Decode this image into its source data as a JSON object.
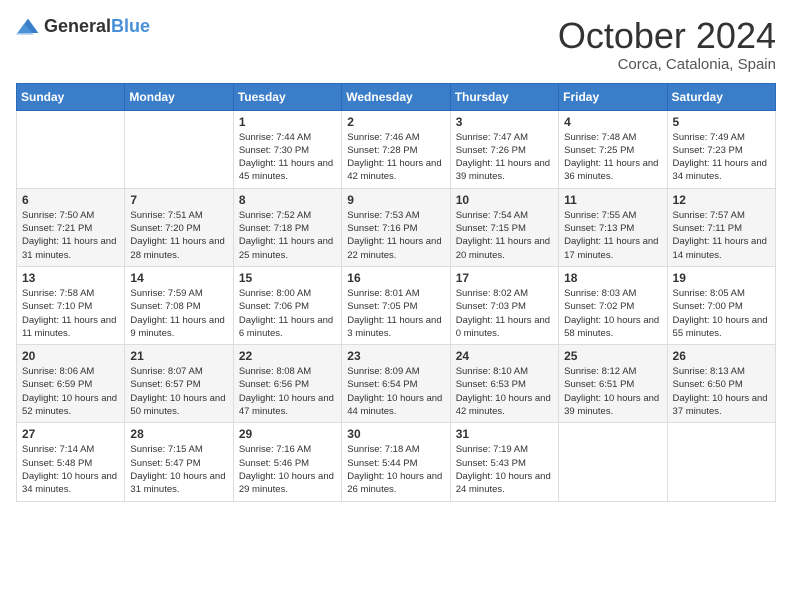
{
  "header": {
    "logo_general": "General",
    "logo_blue": "Blue",
    "month": "October 2024",
    "location": "Corca, Catalonia, Spain"
  },
  "weekdays": [
    "Sunday",
    "Monday",
    "Tuesday",
    "Wednesday",
    "Thursday",
    "Friday",
    "Saturday"
  ],
  "weeks": [
    [
      {
        "day": "",
        "info": ""
      },
      {
        "day": "",
        "info": ""
      },
      {
        "day": "1",
        "info": "Sunrise: 7:44 AM\nSunset: 7:30 PM\nDaylight: 11 hours and 45 minutes."
      },
      {
        "day": "2",
        "info": "Sunrise: 7:46 AM\nSunset: 7:28 PM\nDaylight: 11 hours and 42 minutes."
      },
      {
        "day": "3",
        "info": "Sunrise: 7:47 AM\nSunset: 7:26 PM\nDaylight: 11 hours and 39 minutes."
      },
      {
        "day": "4",
        "info": "Sunrise: 7:48 AM\nSunset: 7:25 PM\nDaylight: 11 hours and 36 minutes."
      },
      {
        "day": "5",
        "info": "Sunrise: 7:49 AM\nSunset: 7:23 PM\nDaylight: 11 hours and 34 minutes."
      }
    ],
    [
      {
        "day": "6",
        "info": "Sunrise: 7:50 AM\nSunset: 7:21 PM\nDaylight: 11 hours and 31 minutes."
      },
      {
        "day": "7",
        "info": "Sunrise: 7:51 AM\nSunset: 7:20 PM\nDaylight: 11 hours and 28 minutes."
      },
      {
        "day": "8",
        "info": "Sunrise: 7:52 AM\nSunset: 7:18 PM\nDaylight: 11 hours and 25 minutes."
      },
      {
        "day": "9",
        "info": "Sunrise: 7:53 AM\nSunset: 7:16 PM\nDaylight: 11 hours and 22 minutes."
      },
      {
        "day": "10",
        "info": "Sunrise: 7:54 AM\nSunset: 7:15 PM\nDaylight: 11 hours and 20 minutes."
      },
      {
        "day": "11",
        "info": "Sunrise: 7:55 AM\nSunset: 7:13 PM\nDaylight: 11 hours and 17 minutes."
      },
      {
        "day": "12",
        "info": "Sunrise: 7:57 AM\nSunset: 7:11 PM\nDaylight: 11 hours and 14 minutes."
      }
    ],
    [
      {
        "day": "13",
        "info": "Sunrise: 7:58 AM\nSunset: 7:10 PM\nDaylight: 11 hours and 11 minutes."
      },
      {
        "day": "14",
        "info": "Sunrise: 7:59 AM\nSunset: 7:08 PM\nDaylight: 11 hours and 9 minutes."
      },
      {
        "day": "15",
        "info": "Sunrise: 8:00 AM\nSunset: 7:06 PM\nDaylight: 11 hours and 6 minutes."
      },
      {
        "day": "16",
        "info": "Sunrise: 8:01 AM\nSunset: 7:05 PM\nDaylight: 11 hours and 3 minutes."
      },
      {
        "day": "17",
        "info": "Sunrise: 8:02 AM\nSunset: 7:03 PM\nDaylight: 11 hours and 0 minutes."
      },
      {
        "day": "18",
        "info": "Sunrise: 8:03 AM\nSunset: 7:02 PM\nDaylight: 10 hours and 58 minutes."
      },
      {
        "day": "19",
        "info": "Sunrise: 8:05 AM\nSunset: 7:00 PM\nDaylight: 10 hours and 55 minutes."
      }
    ],
    [
      {
        "day": "20",
        "info": "Sunrise: 8:06 AM\nSunset: 6:59 PM\nDaylight: 10 hours and 52 minutes."
      },
      {
        "day": "21",
        "info": "Sunrise: 8:07 AM\nSunset: 6:57 PM\nDaylight: 10 hours and 50 minutes."
      },
      {
        "day": "22",
        "info": "Sunrise: 8:08 AM\nSunset: 6:56 PM\nDaylight: 10 hours and 47 minutes."
      },
      {
        "day": "23",
        "info": "Sunrise: 8:09 AM\nSunset: 6:54 PM\nDaylight: 10 hours and 44 minutes."
      },
      {
        "day": "24",
        "info": "Sunrise: 8:10 AM\nSunset: 6:53 PM\nDaylight: 10 hours and 42 minutes."
      },
      {
        "day": "25",
        "info": "Sunrise: 8:12 AM\nSunset: 6:51 PM\nDaylight: 10 hours and 39 minutes."
      },
      {
        "day": "26",
        "info": "Sunrise: 8:13 AM\nSunset: 6:50 PM\nDaylight: 10 hours and 37 minutes."
      }
    ],
    [
      {
        "day": "27",
        "info": "Sunrise: 7:14 AM\nSunset: 5:48 PM\nDaylight: 10 hours and 34 minutes."
      },
      {
        "day": "28",
        "info": "Sunrise: 7:15 AM\nSunset: 5:47 PM\nDaylight: 10 hours and 31 minutes."
      },
      {
        "day": "29",
        "info": "Sunrise: 7:16 AM\nSunset: 5:46 PM\nDaylight: 10 hours and 29 minutes."
      },
      {
        "day": "30",
        "info": "Sunrise: 7:18 AM\nSunset: 5:44 PM\nDaylight: 10 hours and 26 minutes."
      },
      {
        "day": "31",
        "info": "Sunrise: 7:19 AM\nSunset: 5:43 PM\nDaylight: 10 hours and 24 minutes."
      },
      {
        "day": "",
        "info": ""
      },
      {
        "day": "",
        "info": ""
      }
    ]
  ]
}
